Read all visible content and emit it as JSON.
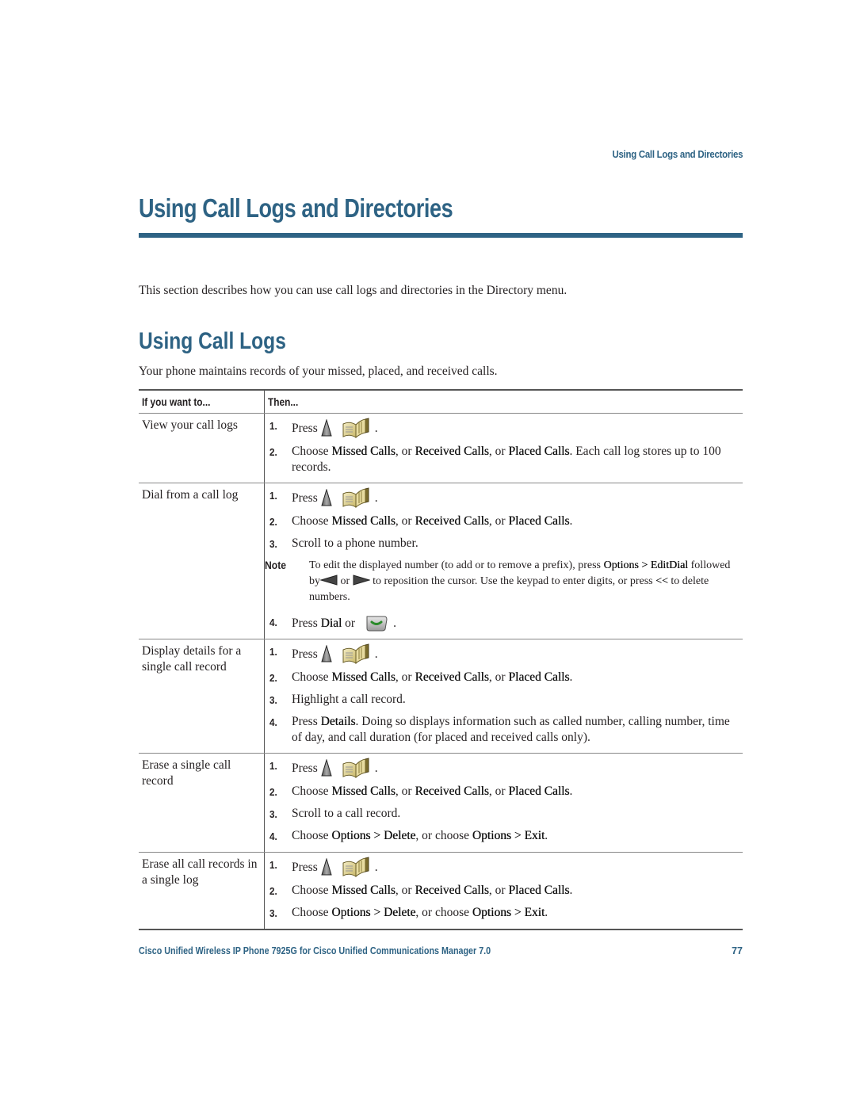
{
  "running_head": "Using Call Logs and Directories",
  "chapter_title": "Using Call Logs and Directories",
  "intro": "This section describes how you can use call logs and directories in the Directory menu.",
  "section": {
    "title": "Using Call Logs",
    "intro": "Your phone maintains records of your missed, placed, and received calls."
  },
  "table": {
    "headers": [
      "If you want to...",
      "Then..."
    ],
    "rows": [
      {
        "task": "View your call logs",
        "steps": {
          "s1": {
            "num": "1.",
            "text": "Press",
            "icons": [
              "nav-up-icon",
              "directory-book-icon"
            ],
            "end": "."
          },
          "s2": {
            "num": "2.",
            "pre": "Choose ",
            "b1": "Missed Calls",
            "m1": ", or ",
            "b2": "Received Calls",
            "m2": ", or ",
            "b3": "Placed Calls",
            "post": ". Each call log stores up to 100 records."
          }
        }
      },
      {
        "task": "Dial from a call log",
        "steps": {
          "s1": {
            "num": "1.",
            "text": "Press",
            "end": "."
          },
          "s2": {
            "num": "2.",
            "pre": "Choose ",
            "b1": "Missed Calls",
            "m1": ", or ",
            "b2": "Received Calls",
            "m2": ", or ",
            "b3": "Placed Calls",
            "post": "."
          },
          "s3": {
            "num": "3.",
            "text": "Scroll to a phone number."
          },
          "note": {
            "label": "Note",
            "t1": "To edit the displayed number (to add or to remove a prefix), press ",
            "b1": "Options > EditDial",
            "t2": " followed by",
            "t3": " or ",
            "t4": " to reposition the cursor. Use the keypad to enter digits, or press ",
            "b2": "<<",
            "t5": " to delete numbers."
          },
          "s4": {
            "num": "4.",
            "pre": "Press ",
            "b1": "Dial",
            "post": " or",
            "end": "."
          }
        }
      },
      {
        "task": "Display details for a single call record",
        "steps": {
          "s1": {
            "num": "1.",
            "text": "Press",
            "end": "."
          },
          "s2": {
            "num": "2.",
            "pre": "Choose ",
            "b1": "Missed Calls",
            "m1": ", or ",
            "b2": "Received Calls",
            "m2": ", or ",
            "b3": "Placed Calls",
            "post": "."
          },
          "s3": {
            "num": "3.",
            "text": "Highlight a call record."
          },
          "s4": {
            "num": "4.",
            "pre": "Press ",
            "b1": "Details",
            "post": ". Doing so displays information such as called number, calling number, time of day, and call duration (for placed and received calls only)."
          }
        }
      },
      {
        "task": "Erase a single call record",
        "steps": {
          "s1": {
            "num": "1.",
            "text": "Press",
            "end": "."
          },
          "s2": {
            "num": "2.",
            "pre": "Choose ",
            "b1": "Missed Calls",
            "m1": ", or ",
            "b2": "Received Calls",
            "m2": ", or ",
            "b3": "Placed Calls",
            "post": "."
          },
          "s3": {
            "num": "3.",
            "text": "Scroll to a call record."
          },
          "s4": {
            "num": "4.",
            "pre": "Choose ",
            "b1": "Options > Delete",
            "m1": ", or choose ",
            "b2": "Options > Exit",
            "post": "."
          }
        }
      },
      {
        "task": "Erase all call records in a single log",
        "steps": {
          "s1": {
            "num": "1.",
            "text": "Press",
            "end": "."
          },
          "s2": {
            "num": "2.",
            "pre": "Choose ",
            "b1": "Missed Calls",
            "m1": ", or ",
            "b2": "Received Calls",
            "m2": ", or ",
            "b3": "Placed Calls",
            "post": "."
          },
          "s3": {
            "num": "3.",
            "pre": "Choose ",
            "b1": "Options > Delete",
            "m1": ", or choose ",
            "b2": "Options > Exit",
            "post": "."
          }
        }
      }
    ]
  },
  "footer": {
    "title": "Cisco Unified Wireless IP Phone 7925G for Cisco Unified Communications Manager 7.0",
    "page": "77"
  },
  "colors": {
    "accent": "#2e6384"
  }
}
